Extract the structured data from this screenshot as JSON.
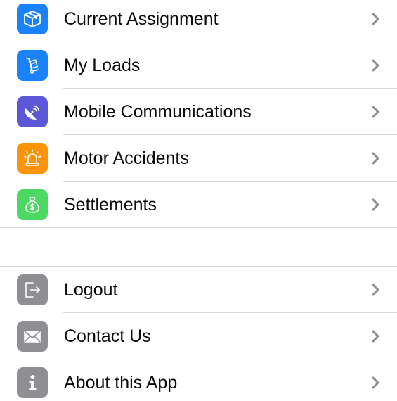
{
  "menu": {
    "items": [
      {
        "label": "Current Assignment",
        "icon": "box-icon",
        "color": "#1a82fb"
      },
      {
        "label": "My Loads",
        "icon": "hand-truck-icon",
        "color": "#1a82fb"
      },
      {
        "label": "Mobile Communications",
        "icon": "satellite-dish-icon",
        "color": "#5b57d6"
      },
      {
        "label": "Motor Accidents",
        "icon": "siren-icon",
        "color": "#fd9408"
      },
      {
        "label": "Settlements",
        "icon": "money-bag-icon",
        "color": "#4bd863"
      }
    ]
  },
  "account": {
    "items": [
      {
        "label": "Logout",
        "icon": "exit-icon",
        "color": "#8e8e93"
      },
      {
        "label": "Contact Us",
        "icon": "envelope-icon",
        "color": "#8e8e93"
      },
      {
        "label": "About this App",
        "icon": "info-icon",
        "color": "#8e8e93"
      }
    ]
  },
  "chevron_color": "#8b8b90"
}
